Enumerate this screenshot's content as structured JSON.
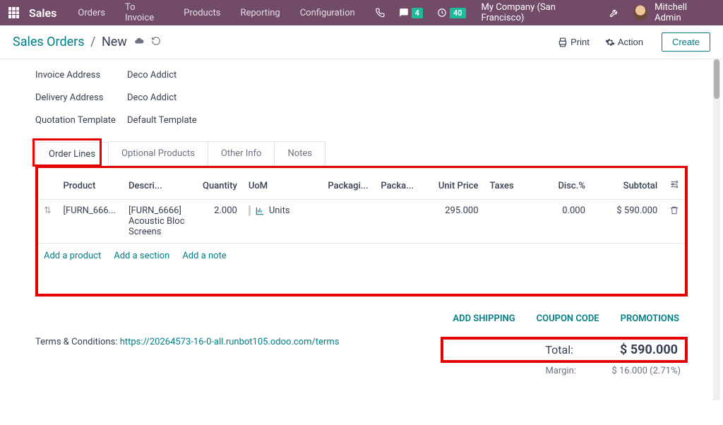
{
  "topnav": {
    "brand": "Sales",
    "items": [
      "Orders",
      "To Invoice",
      "Products",
      "Reporting",
      "Configuration"
    ],
    "msg_count": "4",
    "activity_count": "40",
    "company": "My Company (San Francisco)",
    "user": "Mitchell Admin"
  },
  "actionbar": {
    "breadcrumb_root": "Sales Orders",
    "breadcrumb_current": "New",
    "print": "Print",
    "action": "Action",
    "create": "Create"
  },
  "form": {
    "invoice_address_label": "Invoice Address",
    "invoice_address": "Deco Addict",
    "delivery_address_label": "Delivery Address",
    "delivery_address": "Deco Addict",
    "qtemplate_label": "Quotation Template",
    "qtemplate": "Default Template"
  },
  "tabs": {
    "order_lines": "Order Lines",
    "optional": "Optional Products",
    "other": "Other Info",
    "notes": "Notes"
  },
  "columns": {
    "product": "Product",
    "description": "Descri...",
    "quantity": "Quantity",
    "uom": "UoM",
    "packaging": "Packagi...",
    "packa": "Packa...",
    "unit_price": "Unit Price",
    "taxes": "Taxes",
    "disc": "Disc.%",
    "subtotal": "Subtotal"
  },
  "line": {
    "product": "[FURN_666...",
    "description": "[FURN_6666] Acoustic Bloc Screens",
    "qty": "2.000",
    "uom": "Units",
    "unit_price": "295.000",
    "disc": "0.000",
    "subtotal": "$ 590.000"
  },
  "add": {
    "product": "Add a product",
    "section": "Add a section",
    "note": "Add a note"
  },
  "footer_links": {
    "shipping": "ADD SHIPPING",
    "coupon": "COUPON CODE",
    "promo": "PROMOTIONS"
  },
  "terms": {
    "prefix": "Terms & Conditions: ",
    "link": "https://20264573-16-0-all.runbot105.odoo.com/terms"
  },
  "totals": {
    "total_label": "Total:",
    "total_value": "$ 590.000",
    "margin_label": "Margin:",
    "margin_value": "$ 16.000 (2.71%)"
  }
}
